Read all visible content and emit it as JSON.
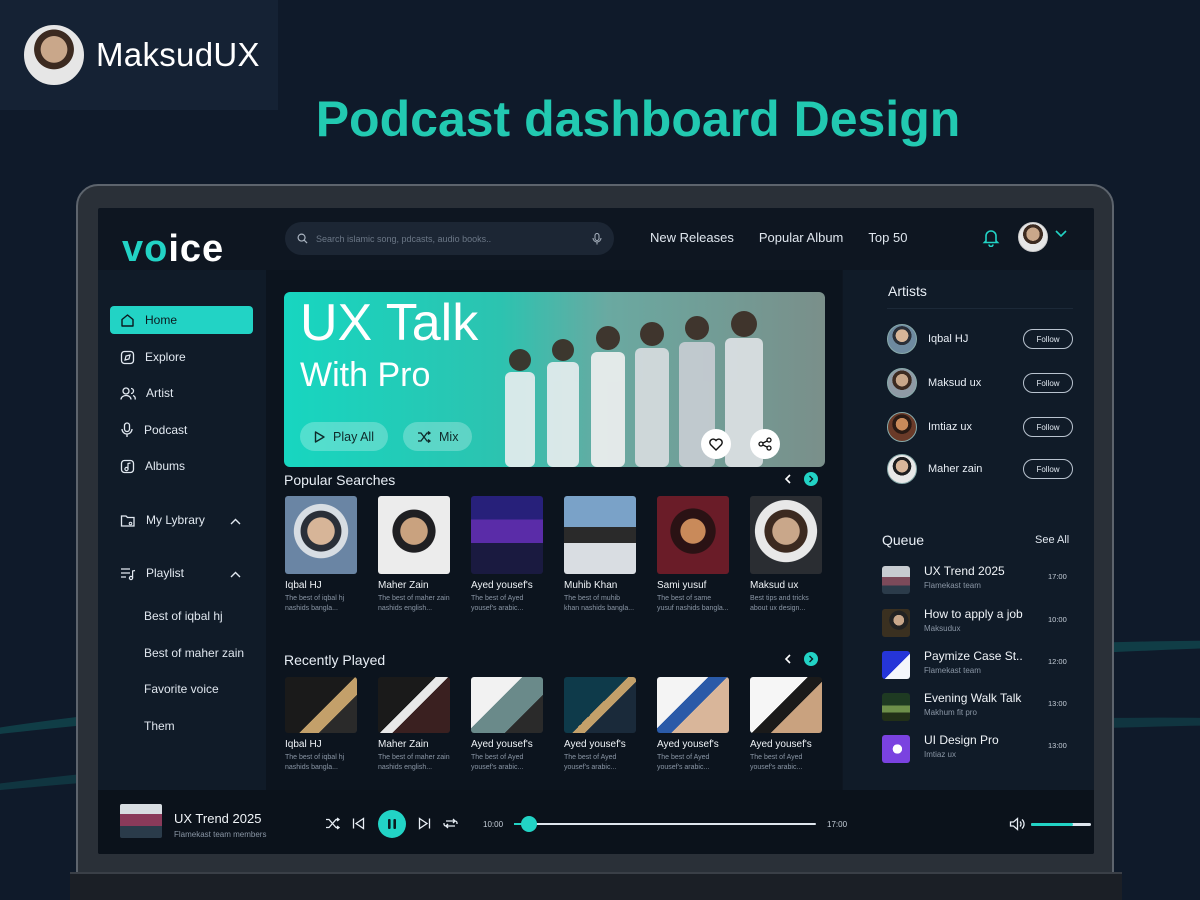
{
  "brand": {
    "name": "MaksudUX"
  },
  "headline": "Podcast dashboard Design",
  "colors": {
    "accent": "#22d3c5",
    "headline": "#22c9b1",
    "bg": "#0f1a2a"
  },
  "app": {
    "logo": {
      "a": "vo",
      "b": "ice"
    },
    "search": {
      "placeholder": "Search islamic song, pdcasts, audio books..",
      "icon": "search-icon",
      "mic": "mic-icon"
    },
    "nav": [
      "New Releases",
      "Popular Album",
      "Top 50"
    ],
    "sidebar": {
      "items": [
        {
          "label": "Home",
          "icon": "home-icon"
        },
        {
          "label": "Explore",
          "icon": "compass-icon"
        },
        {
          "label": "Artist",
          "icon": "users-icon"
        },
        {
          "label": "Podcast",
          "icon": "mic-icon"
        },
        {
          "label": "Albums",
          "icon": "album-icon"
        }
      ],
      "library": "My Lybrary",
      "playlist": "Playlist",
      "playlists": [
        "Best of iqbal hj",
        "Best of maher zain",
        "Favorite voice",
        "Them"
      ]
    },
    "hero": {
      "title": "UX Talk",
      "subtitle": "With Pro",
      "play_all": "Play All",
      "mix": "Mix"
    },
    "popular": {
      "title": "Popular Searches",
      "cards": [
        {
          "name": "Iqbal HJ",
          "d1": "The best of iqbal hj",
          "d2": "nashids bangla..."
        },
        {
          "name": "Maher Zain",
          "d1": "The best of maher zain",
          "d2": "nashids english..."
        },
        {
          "name": "Ayed yousef's",
          "d1": "The best of Ayed",
          "d2": "yousef's arabic..."
        },
        {
          "name": "Muhib Khan",
          "d1": "The best of muhib",
          "d2": "khan nashids bangla..."
        },
        {
          "name": "Sami yusuf",
          "d1": "The best of same",
          "d2": "yusuf nashids bangla..."
        },
        {
          "name": "Maksud ux",
          "d1": "Best tips and tricks",
          "d2": "about ux design..."
        }
      ]
    },
    "recent": {
      "title": "Recently Played",
      "cards": [
        {
          "name": "Iqbal HJ",
          "d1": "The best of iqbal hj",
          "d2": "nashids bangla..."
        },
        {
          "name": "Maher Zain",
          "d1": "The best of maher zain",
          "d2": "nashids english..."
        },
        {
          "name": "Ayed yousef's",
          "d1": "The best of Ayed",
          "d2": "yousef's arabic..."
        },
        {
          "name": "Ayed yousef's",
          "d1": "The best of Ayed",
          "d2": "yousef's arabic..."
        },
        {
          "name": "Ayed yousef's",
          "d1": "The best of Ayed",
          "d2": "yousef's arabic..."
        },
        {
          "name": "Ayed yousef's",
          "d1": "The best of Ayed",
          "d2": "yousef's arabic..."
        }
      ]
    },
    "artists": {
      "title": "Artists",
      "follow": "Follow",
      "list": [
        "Iqbal HJ",
        "Maksud ux",
        "Imtiaz ux",
        "Maher zain"
      ]
    },
    "queue": {
      "title": "Queue",
      "see_all": "See All",
      "items": [
        {
          "title": "UX Trend 2025",
          "sub": "Flamekast team",
          "time": "17:00"
        },
        {
          "title": "How to apply a job",
          "sub": "Maksudux",
          "time": "10:00"
        },
        {
          "title": "Paymize Case St..",
          "sub": "Flamekast team",
          "time": "12:00"
        },
        {
          "title": "Evening Walk Talk",
          "sub": "Makhum fit pro",
          "time": "13:00"
        },
        {
          "title": "UI Design Pro",
          "sub": "Imtiaz ux",
          "time": "13:00"
        }
      ]
    },
    "player": {
      "title": "UX Trend 2025",
      "sub": "Flamekast team members",
      "current": "10:00",
      "total": "17:00",
      "progress": 0.03,
      "volume": 0.7
    }
  }
}
